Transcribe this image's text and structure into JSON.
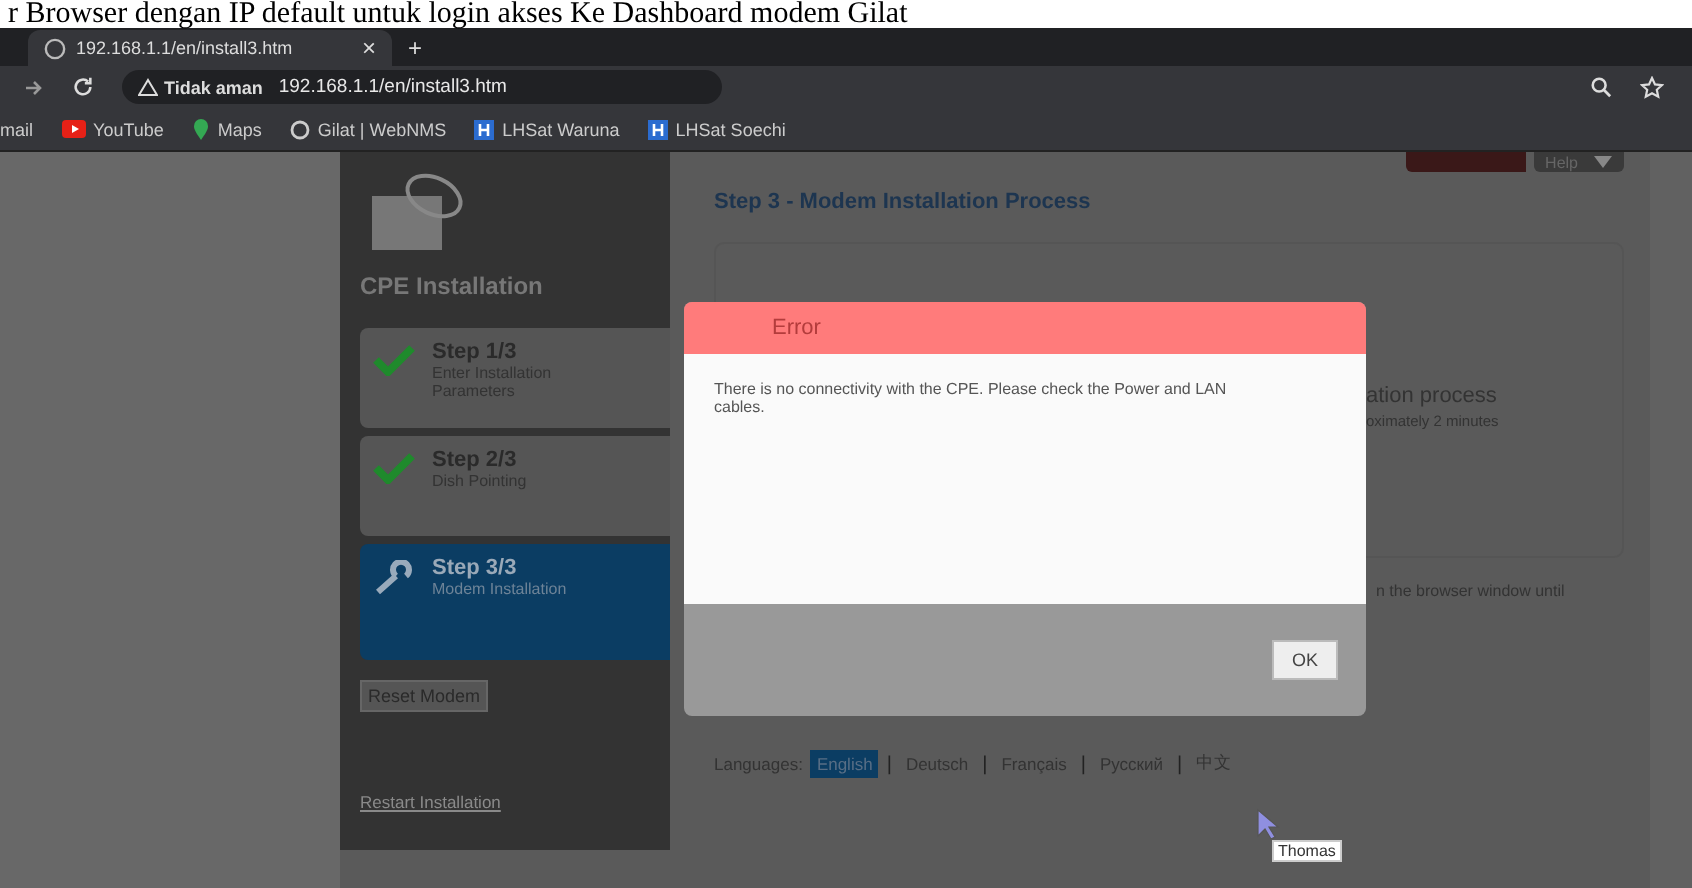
{
  "caption": "r Browser dengan IP default untuk login akses Ke Dashboard modem Gilat",
  "browser": {
    "tab": {
      "title": "192.168.1.1/en/install3.htm",
      "close": "×"
    },
    "new_tab": "+",
    "security": "Tidak aman",
    "url": "192.168.1.1/en/install3.htm",
    "bookmarks": [
      {
        "label": "mail"
      },
      {
        "label": "YouTube"
      },
      {
        "label": "Maps"
      },
      {
        "label": "Gilat | WebNMS"
      },
      {
        "label": "LHSat Waruna"
      },
      {
        "label": "LHSat Soechi"
      }
    ]
  },
  "sidebar": {
    "title": "CPE Installation",
    "steps": [
      {
        "title": "Step 1/3",
        "subtitle": "Enter Installation Parameters",
        "done": true,
        "selected": false
      },
      {
        "title": "Step 2/3",
        "subtitle": "Dish Pointing",
        "done": true,
        "selected": false
      },
      {
        "title": "Step 3/3",
        "subtitle": "Modem Installation",
        "done": false,
        "selected": true
      }
    ],
    "reset_button": "Reset Modem",
    "restart_link": "Restart Installation"
  },
  "header_buttons": [
    {
      "kind": "red"
    },
    {
      "kind": "help",
      "label": "Help"
    }
  ],
  "main": {
    "heading": "Step 3 - Modem Installation Process",
    "fragments": [
      "ation process",
      "oximately 2 minutes"
    ],
    "note": "n the browser window until"
  },
  "languages": {
    "label": "Languages:",
    "separator": "|",
    "items": [
      {
        "label": "English",
        "selected": true
      },
      {
        "label": "Deutsch",
        "selected": false
      },
      {
        "label": "Français",
        "selected": false
      },
      {
        "label": "Русский",
        "selected": false
      },
      {
        "label": "中文",
        "selected": false
      }
    ]
  },
  "dialog": {
    "title": "Error",
    "message": "There is no connectivity with the CPE. Please check the Power and LAN cables.",
    "ok": "OK"
  },
  "tooltip": "Thomas"
}
